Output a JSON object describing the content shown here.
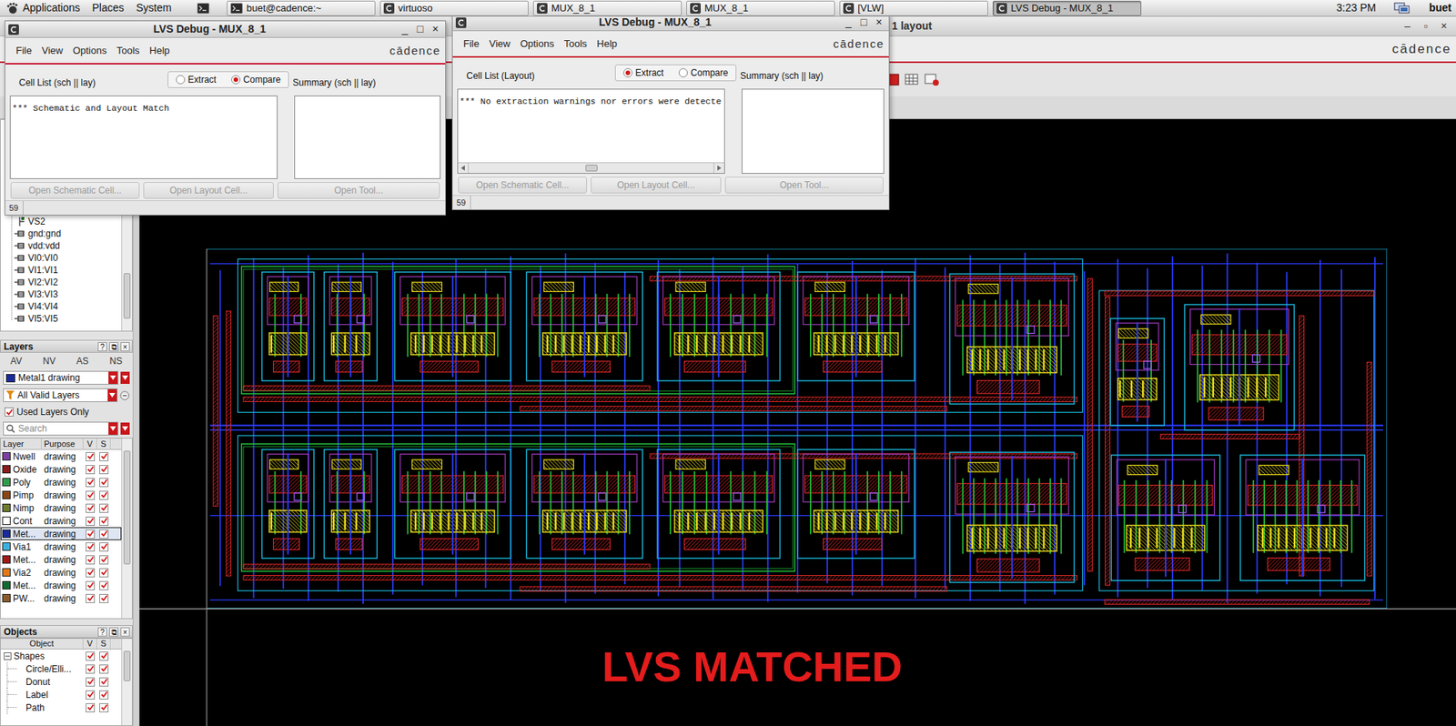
{
  "top_panel": {
    "menus": [
      "Applications",
      "Places",
      "System"
    ],
    "tasks": [
      {
        "label": "buet@cadence:~",
        "selected": false,
        "kind": "terminal"
      },
      {
        "label": "virtuoso",
        "selected": false,
        "kind": "cadence"
      },
      {
        "label": "MUX_8_1",
        "selected": false,
        "kind": "cadence"
      },
      {
        "label": "MUX_8_1",
        "selected": false,
        "kind": "cadence"
      },
      {
        "label": "[VLW]",
        "selected": false,
        "kind": "cadence"
      },
      {
        "label": "LVS Debug - MUX_8_1",
        "selected": true,
        "kind": "cadence"
      }
    ],
    "clock": "3:23 PM",
    "user": "buet"
  },
  "layout_window": {
    "title": "1 layout",
    "controls": [
      "–",
      "▫",
      "×"
    ],
    "logo": "cādence",
    "navigator": [
      {
        "label": "VS2",
        "kind": "instance"
      },
      {
        "label": "gnd:gnd",
        "kind": "pin"
      },
      {
        "label": "vdd:vdd",
        "kind": "pin"
      },
      {
        "label": "VI0:VI0",
        "kind": "pin"
      },
      {
        "label": "VI1:VI1",
        "kind": "pin"
      },
      {
        "label": "VI2:VI2",
        "kind": "pin"
      },
      {
        "label": "VI3:VI3",
        "kind": "pin"
      },
      {
        "label": "VI4:VI4",
        "kind": "pin"
      },
      {
        "label": "VI5:VI5",
        "kind": "pin"
      }
    ],
    "layers_panel": {
      "title": "Layers",
      "controls": [
        "?",
        "⧉",
        "×"
      ],
      "toggles": [
        "AV",
        "NV",
        "AS",
        "NS"
      ],
      "layer_select": {
        "label": "Metal1 drawing",
        "color": "#1a2a9a"
      },
      "filter_select": "All Valid Layers",
      "used_only": {
        "label": "Used Layers Only",
        "checked": true
      },
      "search": {
        "placeholder": "Search"
      },
      "columns": [
        "Layer",
        "Purpose",
        "V",
        "S"
      ],
      "rows": [
        {
          "layer": "Nwell",
          "purpose": "drawing",
          "visible": true,
          "selectable": true,
          "selected": false,
          "color": "#7b3fa0"
        },
        {
          "layer": "Oxide",
          "purpose": "drawing",
          "visible": true,
          "selectable": true,
          "selected": false,
          "color": "#8b1a1a"
        },
        {
          "layer": "Poly",
          "purpose": "drawing",
          "visible": true,
          "selectable": true,
          "selected": false,
          "color": "#2e9b4a"
        },
        {
          "layer": "Pimp",
          "purpose": "drawing",
          "visible": true,
          "selectable": true,
          "selected": false,
          "color": "#8b4513"
        },
        {
          "layer": "Nimp",
          "purpose": "drawing",
          "visible": true,
          "selectable": true,
          "selected": false,
          "color": "#6b7b2f"
        },
        {
          "layer": "Cont",
          "purpose": "drawing",
          "visible": true,
          "selectable": true,
          "selected": false,
          "color": "#ffffff"
        },
        {
          "layer": "Met...",
          "purpose": "drawing",
          "visible": true,
          "selectable": true,
          "selected": true,
          "color": "#1a2a9a"
        },
        {
          "layer": "Via1",
          "purpose": "drawing",
          "visible": true,
          "selectable": true,
          "selected": false,
          "color": "#3ab0e0"
        },
        {
          "layer": "Met...",
          "purpose": "drawing",
          "visible": true,
          "selectable": true,
          "selected": false,
          "color": "#a01818"
        },
        {
          "layer": "Via2",
          "purpose": "drawing",
          "visible": true,
          "selectable": true,
          "selected": false,
          "color": "#e07818"
        },
        {
          "layer": "Met...",
          "purpose": "drawing",
          "visible": true,
          "selectable": true,
          "selected": false,
          "color": "#0f6a30"
        },
        {
          "layer": "PW...",
          "purpose": "drawing",
          "visible": true,
          "selectable": true,
          "selected": false,
          "color": "#8b5a2b"
        }
      ]
    },
    "objects_panel": {
      "title": "Objects",
      "controls": [
        "?",
        "⧉",
        "×"
      ],
      "columns": [
        "Object",
        "V",
        "S"
      ],
      "rows": [
        {
          "label": "Shapes",
          "kind": "group",
          "expanded": true,
          "visible": true,
          "selectable": true
        },
        {
          "label": "Circle/Elli...",
          "kind": "item",
          "expanded": false,
          "visible": true,
          "selectable": true
        },
        {
          "label": "Donut",
          "kind": "item",
          "expanded": false,
          "visible": true,
          "selectable": true
        },
        {
          "label": "Label",
          "kind": "item",
          "expanded": false,
          "visible": true,
          "selectable": true
        },
        {
          "label": "Path",
          "kind": "item",
          "expanded": false,
          "visible": true,
          "selectable": true
        }
      ]
    },
    "banner": "LVS MATCHED"
  },
  "lvs_windows": [
    {
      "title": "LVS Debug - MUX_8_1",
      "controls": [
        "_",
        "□",
        "×"
      ],
      "menus": [
        "File",
        "View",
        "Options",
        "Tools",
        "Help"
      ],
      "logo": "cādence",
      "modes": [
        {
          "label": "Extract",
          "selected": false
        },
        {
          "label": "Compare",
          "selected": true
        }
      ],
      "list_label": "Cell List (sch || lay)",
      "list_lines": [
        "*** Schematic and Layout Match"
      ],
      "has_scrollbar": false,
      "summary_label": "Summary (sch || lay)",
      "buttons": [
        {
          "label": "Open Schematic Cell...",
          "disabled": true
        },
        {
          "label": "Open Layout Cell...",
          "disabled": true
        },
        {
          "label": "Open Tool...",
          "disabled": true
        }
      ],
      "status": "59"
    },
    {
      "title": "LVS Debug - MUX_8_1",
      "controls": [
        "_",
        "□",
        "×"
      ],
      "menus": [
        "File",
        "View",
        "Options",
        "Tools",
        "Help"
      ],
      "logo": "cādence",
      "modes": [
        {
          "label": "Extract",
          "selected": true
        },
        {
          "label": "Compare",
          "selected": false
        }
      ],
      "list_label": "Cell List (Layout)",
      "list_lines": [
        "*** No extraction warnings nor errors were detecte"
      ],
      "has_scrollbar": true,
      "summary_label": "Summary (sch || lay)",
      "buttons": [
        {
          "label": "Open Schematic Cell...",
          "disabled": true
        },
        {
          "label": "Open Layout Cell...",
          "disabled": true
        },
        {
          "label": "Open Tool...",
          "disabled": true
        }
      ],
      "status": "59"
    }
  ]
}
